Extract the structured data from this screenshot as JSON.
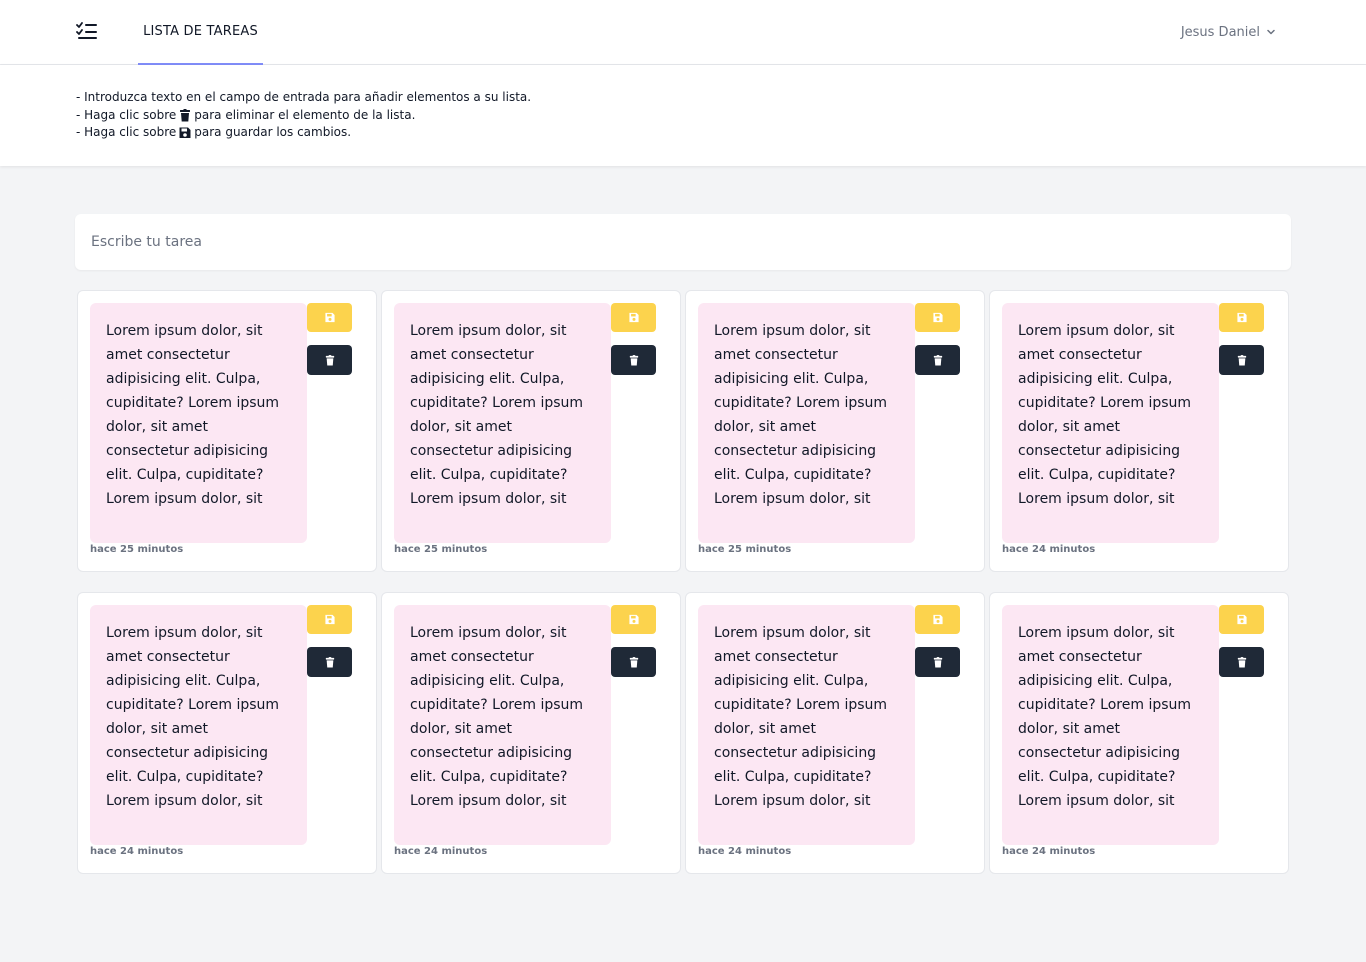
{
  "header": {
    "logo_icon": "checklist-icon",
    "nav_label": "LISTA DE TAREAS",
    "user_name": "Jesus Daniel",
    "accent_color": "#818cf8"
  },
  "instructions": {
    "line1": "- Introduzca texto en el campo de entrada para añadir elementos a su lista.",
    "line2_pre": "- Haga clic sobre",
    "line2_post": "para eliminar el elemento de la lista.",
    "line3_pre": "- Haga clic sobre",
    "line3_post": "para guardar los cambios."
  },
  "search": {
    "placeholder": "Escribe tu tarea",
    "value": ""
  },
  "colors": {
    "note_bg": "#fce7f3",
    "save_button": "#fcd34d",
    "delete_button": "#1f2937"
  },
  "tasks": [
    {
      "text": "Lorem ipsum dolor, sit amet consectetur adipisicing elit. Culpa, cupiditate? Lorem ipsum dolor, sit amet consectetur adipisicing elit. Culpa, cupiditate? Lorem ipsum dolor, sit",
      "time": "hace 25 minutos"
    },
    {
      "text": "Lorem ipsum dolor, sit amet consectetur adipisicing elit. Culpa, cupiditate? Lorem ipsum dolor, sit amet consectetur adipisicing elit. Culpa, cupiditate? Lorem ipsum dolor, sit",
      "time": "hace 25 minutos"
    },
    {
      "text": "Lorem ipsum dolor, sit amet consectetur adipisicing elit. Culpa, cupiditate? Lorem ipsum dolor, sit amet consectetur adipisicing elit. Culpa, cupiditate? Lorem ipsum dolor, sit",
      "time": "hace 25 minutos"
    },
    {
      "text": "Lorem ipsum dolor, sit amet consectetur adipisicing elit. Culpa, cupiditate? Lorem ipsum dolor, sit amet consectetur adipisicing elit. Culpa, cupiditate? Lorem ipsum dolor, sit",
      "time": "hace 24 minutos"
    },
    {
      "text": "Lorem ipsum dolor, sit amet consectetur adipisicing elit. Culpa, cupiditate? Lorem ipsum dolor, sit amet consectetur adipisicing elit. Culpa, cupiditate? Lorem ipsum dolor, sit",
      "time": "hace 24 minutos"
    },
    {
      "text": "Lorem ipsum dolor, sit amet consectetur adipisicing elit. Culpa, cupiditate? Lorem ipsum dolor, sit amet consectetur adipisicing elit. Culpa, cupiditate? Lorem ipsum dolor, sit",
      "time": "hace 24 minutos"
    },
    {
      "text": "Lorem ipsum dolor, sit amet consectetur adipisicing elit. Culpa, cupiditate? Lorem ipsum dolor, sit amet consectetur adipisicing elit. Culpa, cupiditate? Lorem ipsum dolor, sit",
      "time": "hace 24 minutos"
    },
    {
      "text": "Lorem ipsum dolor, sit amet consectetur adipisicing elit. Culpa, cupiditate? Lorem ipsum dolor, sit amet consectetur adipisicing elit. Culpa, cupiditate? Lorem ipsum dolor, sit",
      "time": "hace 24 minutos"
    }
  ]
}
